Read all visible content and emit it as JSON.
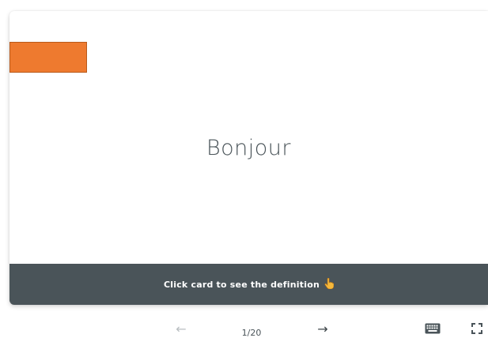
{
  "flashcard": {
    "term": "Bonjour",
    "hint": "Click card to see the definition",
    "hint_emoji_icon": "pointing-hand-icon"
  },
  "controls": {
    "prev_icon": "arrow-left-icon",
    "prev_glyph": "←",
    "counter": "1/20",
    "next_icon": "arrow-right-icon",
    "next_glyph": "→",
    "keyboard_icon": "keyboard-icon",
    "fullscreen_icon": "fullscreen-icon"
  },
  "colors": {
    "accent_orange": "#ee7a2f",
    "hint_bar_bg": "#4a5459",
    "term_text": "#4a5459",
    "disabled_arrow": "#b9bec1"
  }
}
